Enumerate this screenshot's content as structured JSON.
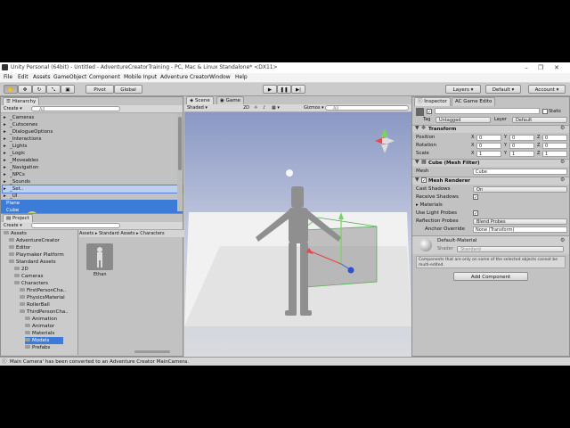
{
  "window": {
    "title": "Unity Personal (64bit) - Untitled - AdventureCreatorTraining - PC, Mac & Linux Standalone* <DX11>",
    "minimize": "–",
    "maximize": "❐",
    "close": "✕"
  },
  "menu": [
    "File",
    "Edit",
    "Assets",
    "GameObject",
    "Component",
    "Mobile Input",
    "Adventure Creator",
    "Window",
    "Help"
  ],
  "toolbar": {
    "pivot": "Pivot",
    "global": "Global",
    "layers": "Layers",
    "layout": "Default",
    "account": "Account"
  },
  "hierarchy": {
    "tab": "Hierarchy",
    "create": "Create",
    "search": "All",
    "items": [
      "_Cameras",
      "_Cutscenes",
      "_DialogueOptions",
      "_Interactions",
      "_Lights",
      "_Logic",
      "_Moveables",
      "_Navigation",
      "_NPCs",
      "_Sounds",
      "_Set..",
      "_UI",
      "Plane",
      "Cube"
    ]
  },
  "scene": {
    "tab_scene": "Scene",
    "tab_game": "Game",
    "shading": "Shaded",
    "mode2d": "2D",
    "gizmos": "Gizmos",
    "search": "All"
  },
  "project": {
    "tab": "Project",
    "create": "Create",
    "breadcrumb": [
      "Assets",
      "Standard Assets",
      "Characters"
    ],
    "tree": [
      "Assets",
      "AdventureCreator",
      "Editor",
      "Playmaker Platform",
      "Standard Assets",
      "2D",
      "Cameras",
      "Characters",
      "FirstPersonCha..",
      "PhysicsMaterial",
      "RollerBall",
      "ThirdPersonCha..",
      "Animation",
      "Animator",
      "Materials",
      "Models",
      "Prefabs"
    ],
    "asset_name": "Ethan"
  },
  "inspector": {
    "tab": "Inspector",
    "tab2": "AC Game Edito",
    "static": "Static",
    "tag_label": "Tag",
    "tag_value": "Untagged",
    "layer_label": "Layer",
    "layer_value": "Default",
    "transform": {
      "title": "Transform",
      "position": "Position",
      "rotation": "Rotation",
      "scale": "Scale",
      "pos": [
        "0",
        "0",
        "0"
      ],
      "rot": [
        "0",
        "0",
        "0"
      ],
      "scl": [
        "1",
        "1",
        "1"
      ]
    },
    "meshfilter": {
      "title": "Cube (Mesh Filter)",
      "mesh_label": "Mesh",
      "mesh_value": "Cube"
    },
    "meshrenderer": {
      "title": "Mesh Renderer",
      "cast_shadows": "Cast Shadows",
      "cast_value": "On",
      "receive_shadows": "Receive Shadows",
      "materials": "Materials",
      "light_probes": "Use Light Probes",
      "reflection": "Reflection Probes",
      "reflection_value": "Blend Probes",
      "anchor": "Anchor Override",
      "anchor_value": "None (Transform)"
    },
    "material": {
      "name": "Default-Material",
      "shader_label": "Shader",
      "shader_value": "Standard"
    },
    "note": "Components that are only on some of the selected objects cannot be multi-edited.",
    "add_component": "Add Component"
  },
  "status": "Main Camera' has been converted to an Adventure Creator MainCamera."
}
